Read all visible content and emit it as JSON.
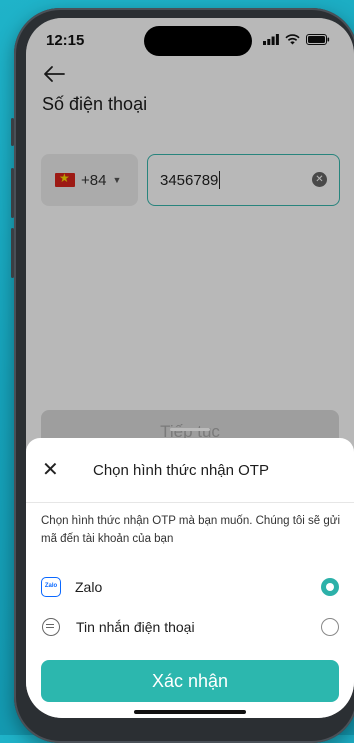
{
  "status_bar": {
    "time": "12:15"
  },
  "header": {
    "title": "Số điện thoại"
  },
  "phone_form": {
    "country_code": "+84",
    "phone_value": "3456789",
    "continue_label": "Tiếp tục"
  },
  "otp_sheet": {
    "title": "Chọn hình thức nhận OTP",
    "description": "Chọn hình thức nhận OTP mà bạn muốn. Chúng tôi sẽ gửi mã đến tài khoản của bạn",
    "options": [
      {
        "label": "Zalo",
        "icon": "zalo-icon",
        "icon_text": "Zalo",
        "selected": true
      },
      {
        "label": "Tin nhắn điện thoại",
        "icon": "message-icon",
        "selected": false
      }
    ],
    "confirm_label": "Xác nhận"
  },
  "colors": {
    "accent": "#2cb7ae",
    "background": "#16a2ba"
  }
}
